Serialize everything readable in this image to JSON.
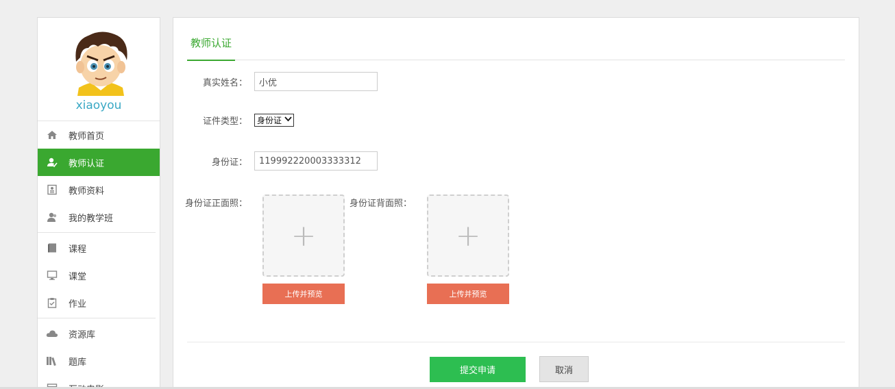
{
  "sidebar": {
    "username": "xiaoyou",
    "items": [
      {
        "label": "教师首页",
        "icon": "home-icon"
      },
      {
        "label": "教师认证",
        "icon": "user-check-icon",
        "active": true
      },
      {
        "label": "教师资料",
        "icon": "profile-card-icon"
      },
      {
        "label": "我的教学班",
        "icon": "class-group-icon"
      },
      {
        "label": "课程",
        "icon": "book-icon"
      },
      {
        "label": "课堂",
        "icon": "monitor-icon"
      },
      {
        "label": "作业",
        "icon": "clipboard-icon"
      },
      {
        "label": "资源库",
        "icon": "cloud-icon"
      },
      {
        "label": "题库",
        "icon": "library-icon"
      },
      {
        "label": "互动电影",
        "icon": "film-icon"
      }
    ]
  },
  "main": {
    "tab": "教师认证",
    "form": {
      "name_label": "真实姓名：",
      "name_value": "小优",
      "id_type_label": "证件类型：",
      "id_type_value": "身份证",
      "id_number_label": "身份证：",
      "id_number_value": "119992220003333312",
      "front_photo_label": "身份证正面照：",
      "back_photo_label": "身份证背面照：",
      "upload_plus": "+",
      "upload_button": "上传并预览"
    },
    "submit_label": "提交申请",
    "cancel_label": "取消"
  },
  "colors": {
    "accent_green": "#3aa830",
    "submit_green": "#2dbe51",
    "upload_orange": "#e86f54",
    "username_blue": "#39a8c4"
  }
}
